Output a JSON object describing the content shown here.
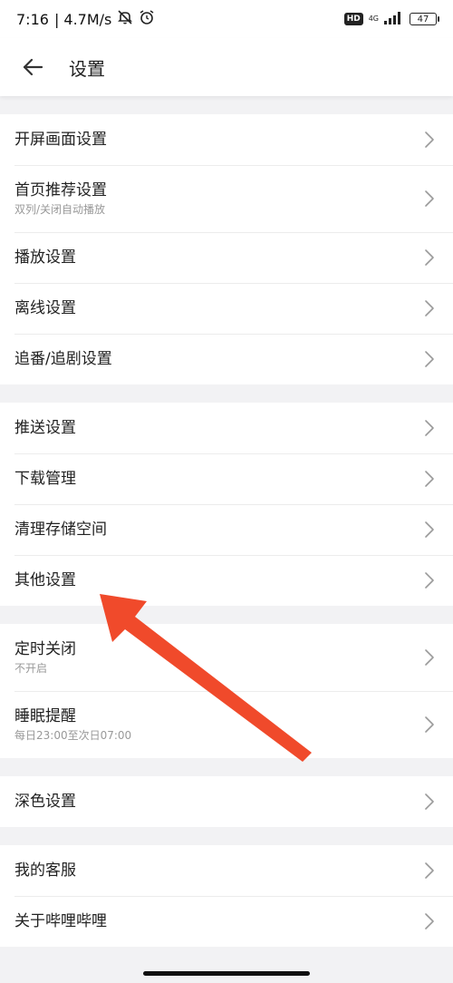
{
  "status_bar": {
    "time": "7:16",
    "net_speed": "| 4.7M/s",
    "hd": "HD",
    "network": "4G",
    "battery": "47"
  },
  "header": {
    "title": "设置"
  },
  "groups": [
    {
      "items": [
        {
          "label": "开屏画面设置"
        },
        {
          "label": "首页推荐设置",
          "sub": "双列/关闭自动播放"
        },
        {
          "label": "播放设置"
        },
        {
          "label": "离线设置"
        },
        {
          "label": "追番/追剧设置"
        }
      ]
    },
    {
      "items": [
        {
          "label": "推送设置"
        },
        {
          "label": "下载管理"
        },
        {
          "label": "清理存储空间"
        },
        {
          "label": "其他设置"
        }
      ]
    },
    {
      "items": [
        {
          "label": "定时关闭",
          "sub": "不开启"
        },
        {
          "label": "睡眠提醒",
          "sub": "每日23:00至次日07:00"
        }
      ]
    },
    {
      "items": [
        {
          "label": "深色设置"
        }
      ]
    },
    {
      "items": [
        {
          "label": "我的客服"
        },
        {
          "label": "关于哔哩哔哩"
        }
      ]
    }
  ],
  "annotation": {
    "arrow_color": "#f04a2b"
  }
}
